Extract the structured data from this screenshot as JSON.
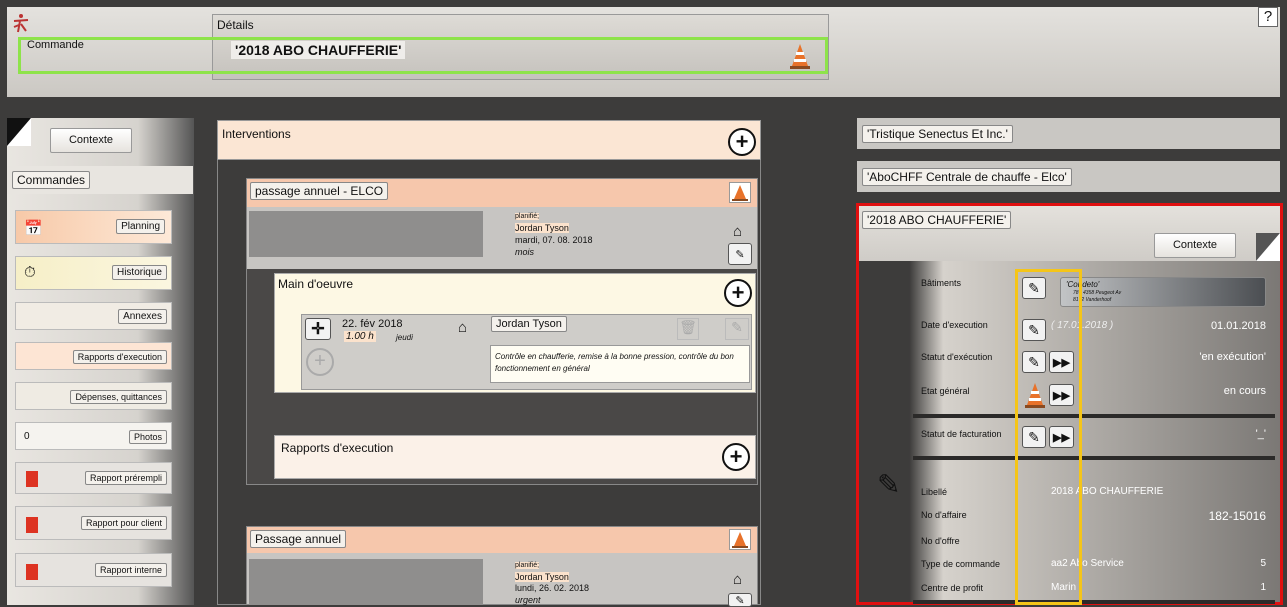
{
  "top": {
    "commande_label": "Commande",
    "details_label": "Détails",
    "order_title": "'2018 ABO CHAUFFERIE'",
    "help": "?"
  },
  "left": {
    "contexte": "Contexte",
    "commandes": "Commandes",
    "items": [
      {
        "label": "Planning"
      },
      {
        "label": "Historique"
      },
      {
        "label": "Annexes"
      },
      {
        "label": "Rapports d'execution"
      },
      {
        "label": "Dépenses, quittances"
      },
      {
        "label": "Photos",
        "count": "0"
      },
      {
        "label": "Rapport prérempli"
      },
      {
        "label": "Rapport pour client"
      },
      {
        "label": "Rapport interne"
      }
    ]
  },
  "middle": {
    "interventions": "Interventions",
    "card1": {
      "title": "passage annuel - ELCO",
      "planned_label": "planifié;",
      "tech": "Jordan Tyson",
      "date": "mardi,  07. 08. 2018",
      "freq": "mois"
    },
    "main_oeuvre": {
      "title": "Main d'oeuvre",
      "date": "22. fév 2018",
      "hours": "1.00 h",
      "day": "jeudi",
      "worker": "Jordan Tyson",
      "desc": "Contrôle en chaufferie, remise à la bonne pression, contrôle du bon fonctionnement en général"
    },
    "rapports": "Rapports d'execution",
    "card2": {
      "title": "Passage annuel",
      "planned_label": "planifié;",
      "tech": "Jordan Tyson",
      "date": "lundi,  26. 02. 2018",
      "freq": "urgent"
    }
  },
  "right": {
    "client": "'Tristique Senectus Et Inc.'",
    "site": "'AboCHFF Centrale de chauffe - Elco'",
    "order_title": "'2018 ABO CHAUFFERIE'",
    "contexte": "Contexte",
    "batiments_label": "Bâtiments",
    "batiment_name": "'Condeto'",
    "batiment_addr1": "78 - 4358 Peugeot Av",
    "batiment_addr2": "8172 Vanderhoof",
    "date_exec_label": "Date d'execution",
    "date_exec_hint": "( 17.01.2018 )",
    "date_exec_value": "01.01.2018",
    "statut_exec_label": "Statut d'exécution",
    "statut_exec_value": "'en exécution'",
    "etat_label": "Etat général",
    "etat_value": "en cours",
    "statut_fact_label": "Statut de facturation",
    "statut_fact_value": "'_'",
    "libelle_label": "Libellé",
    "libelle_value": "2018 ABO CHAUFFERIE",
    "affaire_label": "No d'affaire",
    "affaire_value": "182-15016",
    "offre_label": "No d'offre",
    "type_label": "Type de commande",
    "type_value": "aa2 Abo Service",
    "type_num": "5",
    "centre_label": "Centre de profit",
    "centre_value": "Marin",
    "centre_num": "1"
  },
  "colors": {
    "highlight_green": "#8ee34a",
    "highlight_red": "#e01010",
    "highlight_yellow": "#f5c518"
  }
}
